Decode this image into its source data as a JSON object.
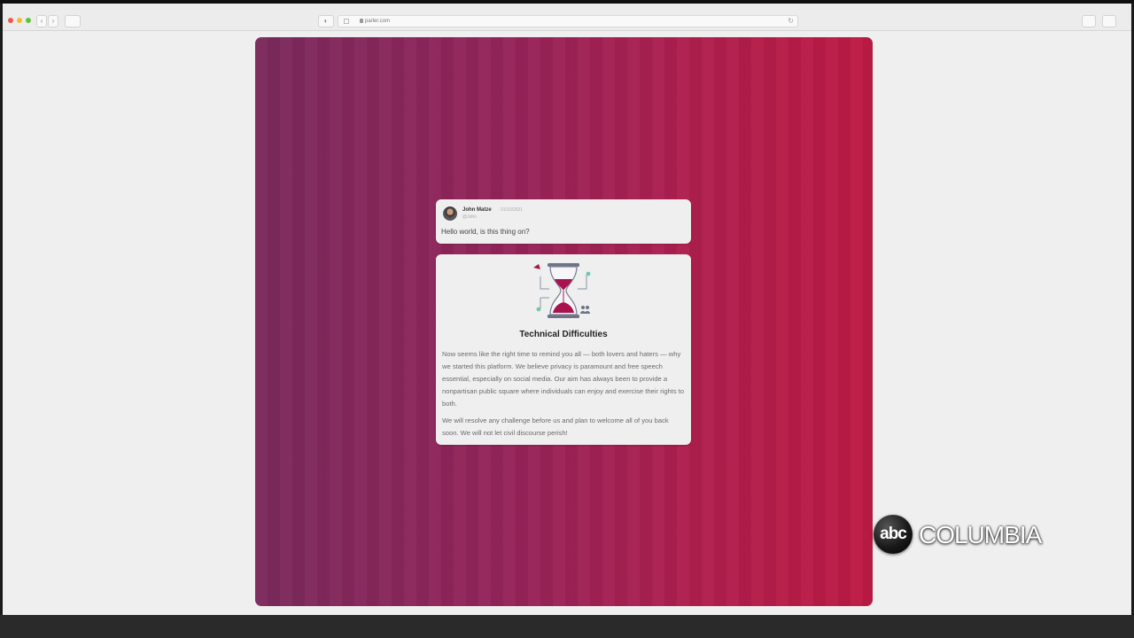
{
  "browser": {
    "url": "parler.com",
    "reload_glyph": "↻",
    "back_glyph": "‹",
    "forward_glyph": "›",
    "shield_glyph": "◐"
  },
  "post": {
    "author": "John Matze",
    "date": "· 01/10/2021",
    "handle": "@John",
    "text": "Hello world, is this thing on?"
  },
  "notice": {
    "title": "Technical Difficulties",
    "paragraphs": [
      "Now seems like the right time to remind you all — both lovers and haters — why we started this platform. We believe privacy is paramount and free speech essential, especially on social media. Our aim has always been to provide a nonpartisan public square where individuals can enjoy and exercise their rights to both.",
      "We will resolve any challenge before us and plan to welcome all of you back soon. We will not let civil discourse perish!"
    ],
    "accent_color": "#a8134f"
  },
  "watermark": {
    "logo_text": "abc",
    "station": "COLUMBIA"
  },
  "colors": {
    "gradient_left": "#7a2a5c",
    "gradient_right": "#bd1a44",
    "card_bg": "#f0efef"
  }
}
